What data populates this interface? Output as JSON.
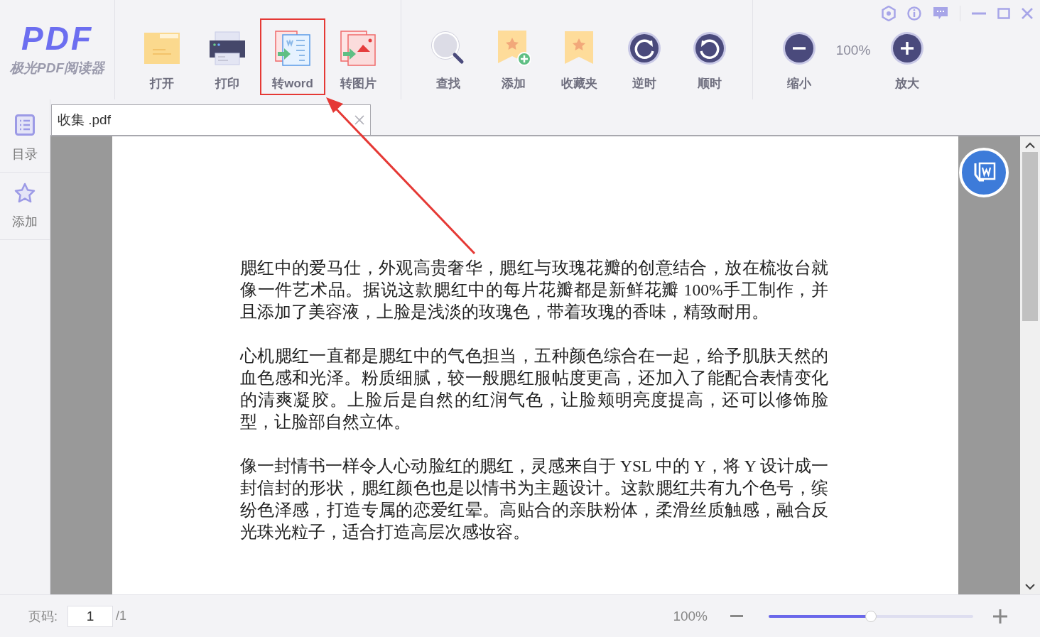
{
  "app": {
    "logo": "PDF",
    "name": "极光PDF阅读器"
  },
  "toolbar": {
    "groups": [
      {
        "items": [
          {
            "kind": "open",
            "label": "打开",
            "highlighted": false
          },
          {
            "kind": "print",
            "label": "打印",
            "highlighted": false
          },
          {
            "kind": "to-word",
            "label": "转word",
            "highlighted": true
          },
          {
            "kind": "to-image",
            "label": "转图片",
            "highlighted": false
          }
        ]
      },
      {
        "items": [
          {
            "kind": "find",
            "label": "查找",
            "highlighted": false
          },
          {
            "kind": "add-bookmark",
            "label": "添加",
            "highlighted": false
          },
          {
            "kind": "bookmarks",
            "label": "收藏夹",
            "highlighted": false
          },
          {
            "kind": "rotate-left",
            "label": "逆时",
            "highlighted": false
          },
          {
            "kind": "rotate-right",
            "label": "顺时",
            "highlighted": false
          }
        ]
      },
      {
        "items": [
          {
            "kind": "zoom-out",
            "label": "缩小",
            "highlighted": false
          },
          {
            "kind": "reading",
            "label": "100%"
          },
          {
            "kind": "zoom-in",
            "label": "放大",
            "highlighted": false
          }
        ]
      }
    ]
  },
  "sidebar": {
    "items": [
      {
        "kind": "contents",
        "label": "目录"
      },
      {
        "kind": "bookmark",
        "label": "添加"
      }
    ]
  },
  "tabs": [
    {
      "title": "收集 .pdf",
      "selected": true
    }
  ],
  "document": {
    "paragraphs": [
      "腮红中的爱马仕，外观高贵奢华，腮红与玫瑰花瓣的创意结合，放在梳妆台就像一件艺术品。据说这款腮红中的每片花瓣都是新鲜花瓣 100%手工制作，并且添加了美容液，上脸是浅淡的玫瑰色，带着玫瑰的香味，精致耐用。",
      "心机腮红一直都是腮红中的气色担当，五种颜色综合在一起，给予肌肤天然的血色感和光泽。粉质细腻，较一般腮红服帖度更高，还加入了能配合表情变化的清爽凝胶。上脸后是自然的红润气色，让脸颊明亮度提高，还可以修饰脸型，让脸部自然立体。",
      "像一封情书一样令人心动脸红的腮红，灵感来自于 YSL 中的 Y，将 Y 设计成一封信封的形状，腮红颜色也是以情书为主题设计。这款腮红共有九个色号，缤纷色泽感，打造专属的恋爱红晕。高贴合的亲肤粉体，柔滑丝质触感，融合反光珠光粒子，适合打造高层次感妆容。"
    ]
  },
  "status_bar": {
    "page_label": "页码:",
    "page": "1",
    "total": "/1",
    "zoom": "100%",
    "zoom_slider": {
      "level": 0.5
    }
  }
}
